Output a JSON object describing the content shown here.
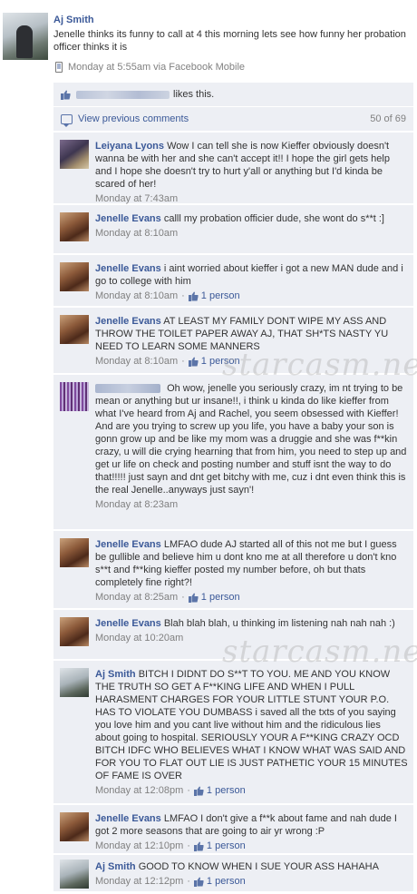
{
  "post": {
    "author": "Aj Smith",
    "text": "Jenelle thinks its funny to call at 4 this morning lets see how funny her probation officer thinks it is",
    "timestamp": "Monday at 5:55am via Facebook Mobile",
    "icon": "mobile-phone-icon"
  },
  "likes_bar": {
    "suffix": "likes this."
  },
  "comments_bar": {
    "view_previous": "View previous comments",
    "count": "50 of 69"
  },
  "comments": [
    {
      "author": "Leiyana Lyons",
      "text": "Wow I can tell she is now Kieffer obviously doesn't wanna be with her and she can't accept it!! I hope the girl gets help and I hope she doesn't try to hurt y'all or anything but I'd kinda be scared of her!",
      "time": "Monday at 7:43am",
      "likes": ""
    },
    {
      "author": "Jenelle Evans",
      "text": "calll my probation officier dude, she wont do s**t :]",
      "time": "Monday at 8:10am",
      "likes": ""
    },
    {
      "author": "Jenelle Evans",
      "text": "i aint worried about kieffer i got a new MAN dude and i go to college with him",
      "time": "Monday at 8:10am",
      "likes": "1 person"
    },
    {
      "author": "Jenelle Evans",
      "text": "AT LEAST MY FAMILY DONT WIPE MY ASS AND THROW THE TOILET PAPER AWAY AJ, THAT SH*TS NASTY YU NEED TO LEARN SOME MANNERS",
      "time": "Monday at 8:10am",
      "likes": "1 person"
    },
    {
      "author": "",
      "text": "Oh wow, jenelle you seriously crazy, im nt trying to be mean or anything but ur insane!!, i think u kinda do like kieffer from what I've heard from Aj and Rachel, you seem obsessed with Kieffer! And are you trying to screw up you life, you have a baby your son is gonn grow up and be like my mom was a druggie and she was f**kin crazy, u will die crying hearning that from him, you need to step up and get ur life on check and posting number and stuff isnt the way to do that!!!!! just sayn and dnt get bitchy with me, cuz i dnt even think this is the real Jenelle..anyways just sayn'!",
      "time": "Monday at 8:23am",
      "likes": ""
    },
    {
      "author": "Jenelle Evans",
      "text": "LMFAO dude AJ started all of this not me but I guess be gullible and believe him u dont kno me at all therefore u don't kno s**t and f**king kieffer posted my number before, oh but thats completely fine right?!",
      "time": "Monday at 8:25am",
      "likes": "1 person"
    },
    {
      "author": "Jenelle Evans",
      "text": "Blah blah blah, u thinking im listening nah nah nah :)",
      "time": "Monday at 10:20am",
      "likes": ""
    },
    {
      "author": "Aj Smith",
      "text": "BITCH I DIDNT DO S**T TO YOU. ME AND YOU KNOW THE TRUTH SO GET A F**KING LIFE AND WHEN I PULL HARASMENT CHARGES FOR YOUR LITTLE STUNT YOUR P.O. HAS TO VIOLATE YOU DUMBASS i saved all the txts of you saying you love him and you cant live without him and the ridiculous lies about going to hospital. SERIOUSLY YOUR A F**KING CRAZY OCD BITCH IDFC WHO BELIEVES WHAT I KNOW WHAT WAS SAID AND FOR YOU TO FLAT OUT LIE IS JUST PATHETIC YOUR 15 MINUTES OF FAME IS OVER",
      "time": "Monday at 12:08pm",
      "likes": "1 person"
    },
    {
      "author": "Jenelle Evans",
      "text": "LMFAO I don't give a f**k about fame and nah dude I got 2 more seasons that are going to air yr wrong :P",
      "time": "Monday at 12:10pm",
      "likes": "1 person"
    },
    {
      "author": "Aj Smith",
      "text": "GOOD TO KNOW WHEN I SUE YOUR ASS HAHAHA",
      "time": "Monday at 12:12pm",
      "likes": "1 person"
    }
  ],
  "meta_separator": "·",
  "watermark": "starcasm.net",
  "colors": {
    "link_blue": "#3b5998",
    "comment_bg": "#edeff4",
    "meta_gray": "#808080"
  }
}
